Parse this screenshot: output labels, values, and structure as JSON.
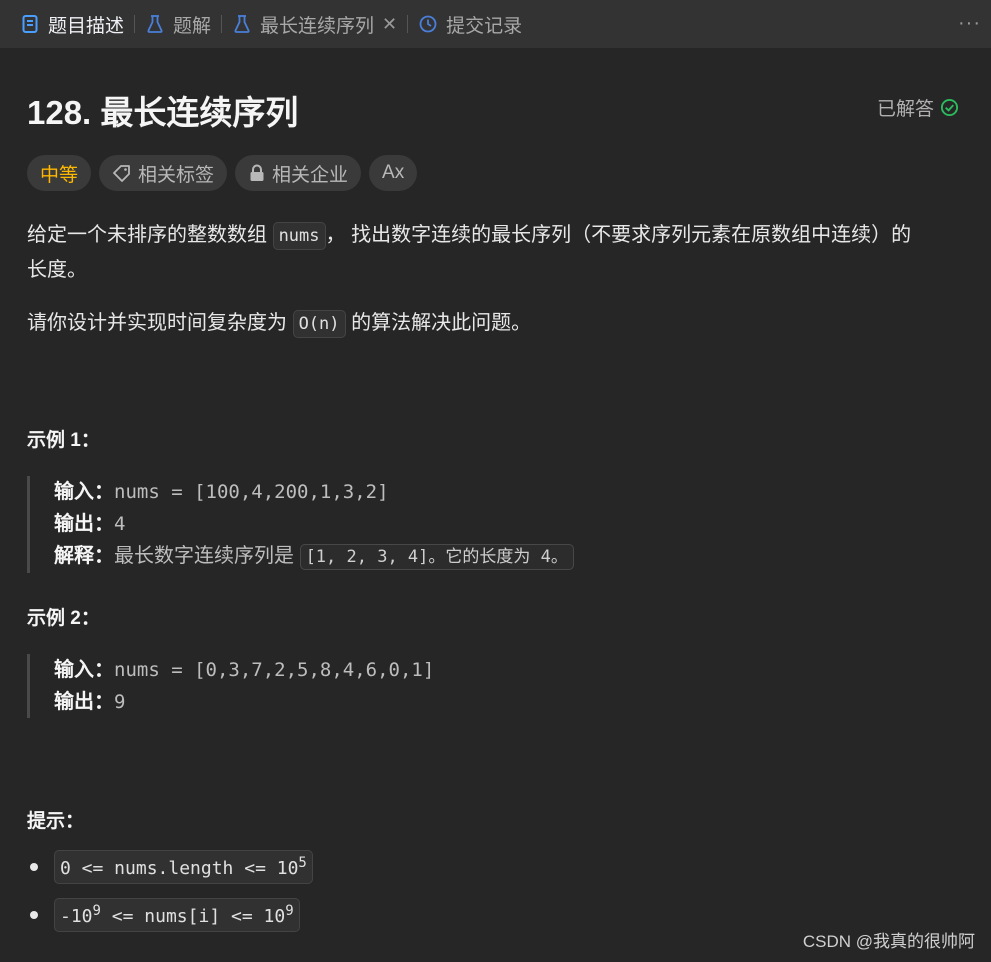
{
  "tabs": [
    {
      "label": "题目描述",
      "icon": "document-icon"
    },
    {
      "label": "题解",
      "icon": "flask-icon"
    },
    {
      "label": "最长连续序列",
      "icon": "flask-icon",
      "closable": true
    },
    {
      "label": "提交记录",
      "icon": "history-icon"
    }
  ],
  "more": "···",
  "problem": {
    "title": "128. 最长连续序列",
    "status": "已解答",
    "difficulty": "中等",
    "tags_label": "相关标签",
    "companies_label": "相关企业",
    "translate_label": "Ax"
  },
  "description": {
    "p1_before": "给定一个未排序的整数数组 ",
    "p1_code": "nums",
    "p1_after": "， 找出数字连续的最长序列（不要求序列元素在原数组中连续）的",
    "p1_line2": "长度。",
    "p2_before": "请你设计并实现时间复杂度为 ",
    "p2_code": "O(n)",
    "p2_after": " 的算法解决此问题。"
  },
  "example1": {
    "heading": "示例 1：",
    "input_label": "输入：",
    "input_value": "nums = [100,4,200,1,3,2]",
    "output_label": "输出：",
    "output_value": "4",
    "explain_label": "解释：",
    "explain_text": "最长数字连续序列是 ",
    "explain_code": "[1, 2, 3, 4]。它的长度为 4。"
  },
  "example2": {
    "heading": "示例 2：",
    "input_label": "输入：",
    "input_value": "nums = [0,3,7,2,5,8,4,6,0,1]",
    "output_label": "输出：",
    "output_value": "9"
  },
  "hints": {
    "heading": "提示：",
    "h1_text": "0 <= nums.length <= 10",
    "h1_sup": "5",
    "h2_pre": "-10",
    "h2_pre_sup": "9",
    "h2_mid": " <= nums[i] <= 10",
    "h2_sup": "9"
  },
  "watermark": "CSDN @我真的很帅阿"
}
